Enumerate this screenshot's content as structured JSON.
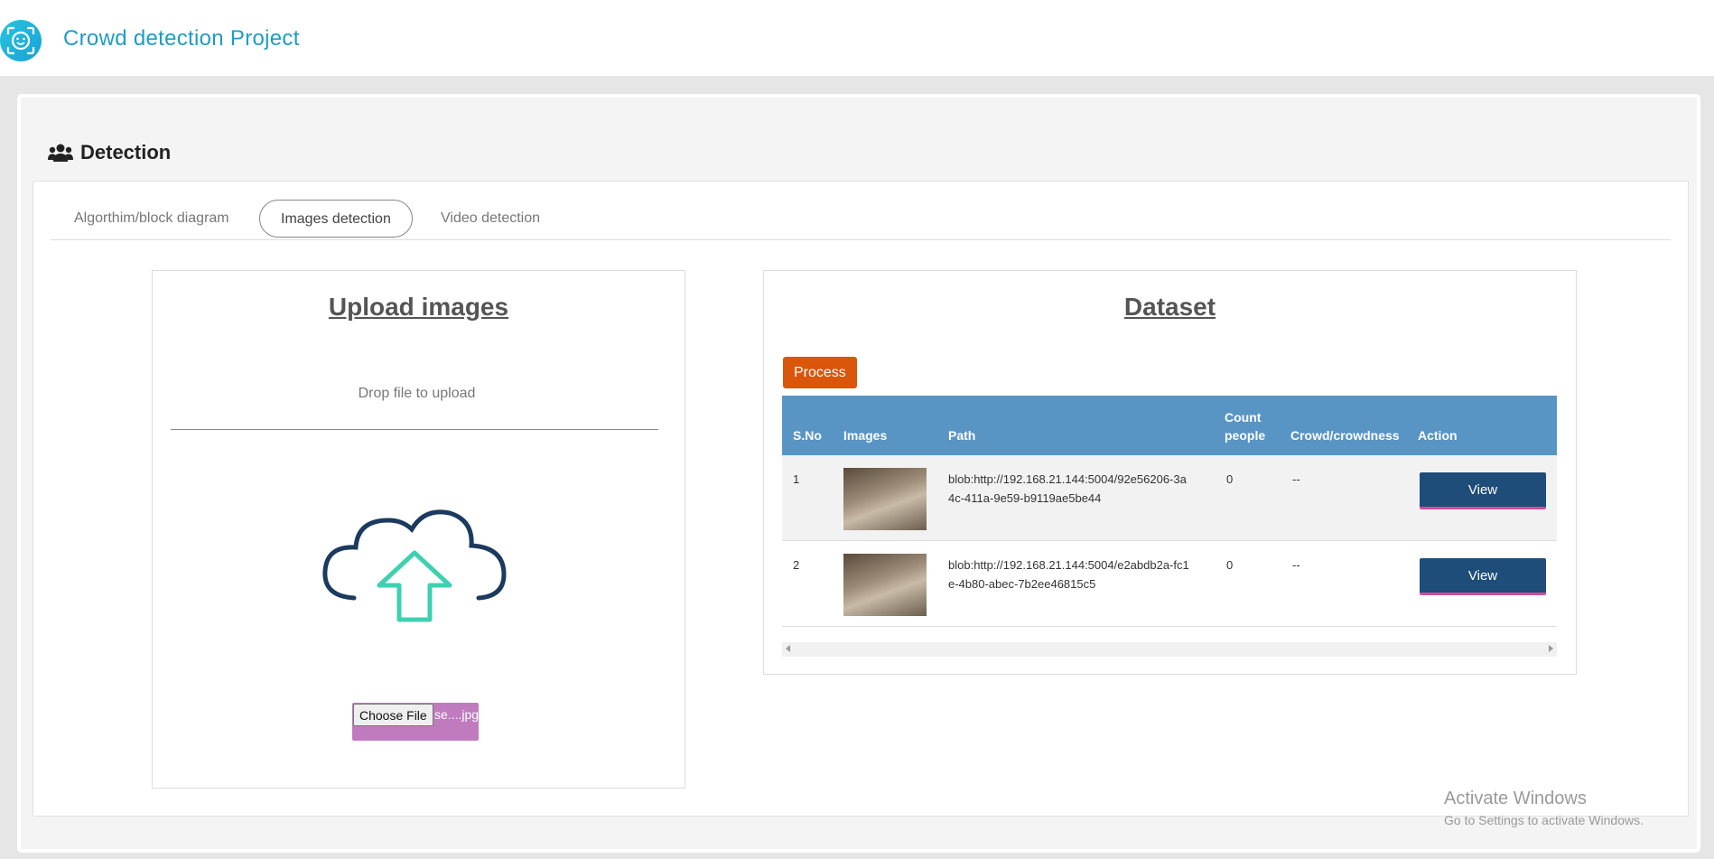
{
  "app": {
    "title": "Crowd detection Project"
  },
  "page": {
    "section_title": "Detection"
  },
  "tabs": [
    {
      "label": "Algorthim/block diagram",
      "active": false
    },
    {
      "label": "Images detection",
      "active": true
    },
    {
      "label": "Video detection",
      "active": false
    }
  ],
  "upload": {
    "heading": "Upload images",
    "drop_text": "Drop file to upload",
    "choose_label": "Choose File",
    "file_name": "se....jpg"
  },
  "dataset": {
    "heading": "Dataset",
    "process_label": "Process",
    "columns": [
      "S.No",
      "Images",
      "Path",
      "Count people",
      "Crowd/crowdness",
      "Action"
    ],
    "rows": [
      {
        "sno": "1",
        "path": "blob:http://192.168.21.144:5004/92e56206-3a4c-411a-9e59-b9119ae5be44",
        "count": "0",
        "crowd": "--",
        "action": "View"
      },
      {
        "sno": "2",
        "path": "blob:http://192.168.21.144:5004/e2abdb2a-fc1e-4b80-abec-7b2ee46815c5",
        "count": "0",
        "crowd": "--",
        "action": "View"
      }
    ]
  },
  "watermark": {
    "line1": "Activate Windows",
    "line2": "Go to Settings to activate Windows."
  },
  "colors": {
    "brand": "#1e9cc4",
    "table_header": "#5895c4",
    "process": "#d9560b",
    "view_button": "#1f4d7a",
    "file_input": "#c07bbf"
  },
  "icons": {
    "logo": "face-scan-icon",
    "section": "users-icon",
    "upload": "cloud-upload-icon"
  }
}
